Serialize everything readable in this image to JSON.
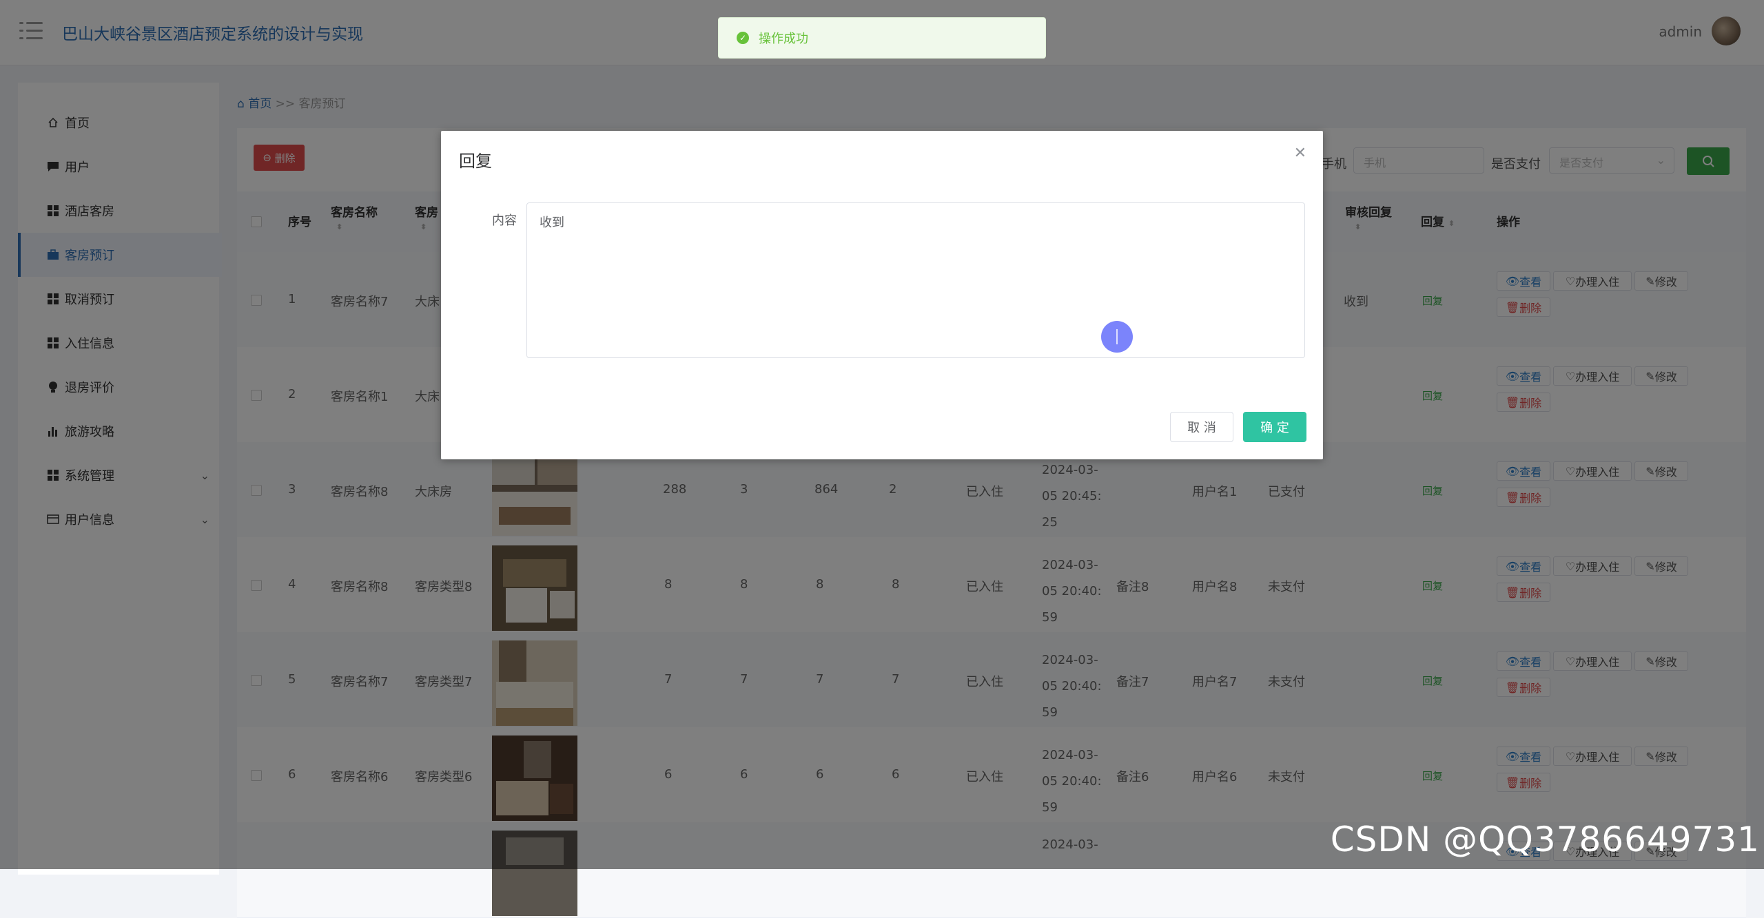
{
  "header": {
    "title": "巴山大峡谷景区酒店预定系统的设计与实现",
    "user": "admin"
  },
  "sidebar": {
    "items": [
      {
        "label": "首页",
        "icon": "home-icon"
      },
      {
        "label": "用户",
        "icon": "chat-icon"
      },
      {
        "label": "酒店客房",
        "icon": "grid-icon"
      },
      {
        "label": "客房预订",
        "icon": "briefcase-icon",
        "active": true
      },
      {
        "label": "取消预订",
        "icon": "grid-icon"
      },
      {
        "label": "入住信息",
        "icon": "grid-icon"
      },
      {
        "label": "退房评价",
        "icon": "bulb-icon"
      },
      {
        "label": "旅游攻略",
        "icon": "bar-chart-icon"
      },
      {
        "label": "系统管理",
        "icon": "grid-icon",
        "expandable": true
      },
      {
        "label": "用户信息",
        "icon": "card-icon",
        "expandable": true
      }
    ]
  },
  "breadcrumb": {
    "home": "首页",
    "sep": ">>",
    "current": "客房预订"
  },
  "toolbar": {
    "delete_label": "删除",
    "phone_label": "手机",
    "phone_placeholder": "手机",
    "paid_label": "是否支付",
    "paid_placeholder": "是否支付"
  },
  "table": {
    "headers": {
      "index": "序号",
      "room_name": "客房名称",
      "room_type": "客房",
      "review_reply": "审核回复",
      "reply": "回复",
      "ops": "操作"
    },
    "actions": {
      "view": "查看",
      "checkin": "办理入住",
      "edit": "修改",
      "delete": "删除",
      "reply": "回复"
    },
    "rows": [
      {
        "index": "1",
        "room_name": "客房名称7",
        "room_type": "大床",
        "review_reply": "收到"
      },
      {
        "index": "2",
        "room_name": "客房名称1",
        "room_type": "大床"
      },
      {
        "index": "3",
        "room_name": "客房名称8",
        "room_type": "大床房",
        "price": "288",
        "days": "3",
        "total": "864",
        "count": "2",
        "status": "已入住",
        "time_a": "2024-03-",
        "time_b": "05 20:45:",
        "time_c": "25",
        "note": "",
        "user": "用户名1",
        "paid": "已支付"
      },
      {
        "index": "4",
        "room_name": "客房名称8",
        "room_type": "客房类型8",
        "price": "8",
        "days": "8",
        "total": "8",
        "count": "8",
        "status": "已入住",
        "time_a": "2024-03-",
        "time_b": "05 20:40:",
        "time_c": "59",
        "note": "备注8",
        "user": "用户名8",
        "paid": "未支付"
      },
      {
        "index": "5",
        "room_name": "客房名称7",
        "room_type": "客房类型7",
        "price": "7",
        "days": "7",
        "total": "7",
        "count": "7",
        "status": "已入住",
        "time_a": "2024-03-",
        "time_b": "05 20:40:",
        "time_c": "59",
        "note": "备注7",
        "user": "用户名7",
        "paid": "未支付"
      },
      {
        "index": "6",
        "room_name": "客房名称6",
        "room_type": "客房类型6",
        "price": "6",
        "days": "6",
        "total": "6",
        "count": "6",
        "status": "已入住",
        "time_a": "2024-03-",
        "time_b": "05 20:40:",
        "time_c": "59",
        "note": "备注6",
        "user": "用户名6",
        "paid": "未支付"
      }
    ],
    "partial_row": {
      "time_a": "2024-03-"
    }
  },
  "dialog": {
    "title": "回复",
    "field_label": "内容",
    "content": "收到",
    "cancel": "取 消",
    "ok": "确 定"
  },
  "toast": {
    "message": "操作成功"
  },
  "watermark": "CSDN @QQ3786649731"
}
